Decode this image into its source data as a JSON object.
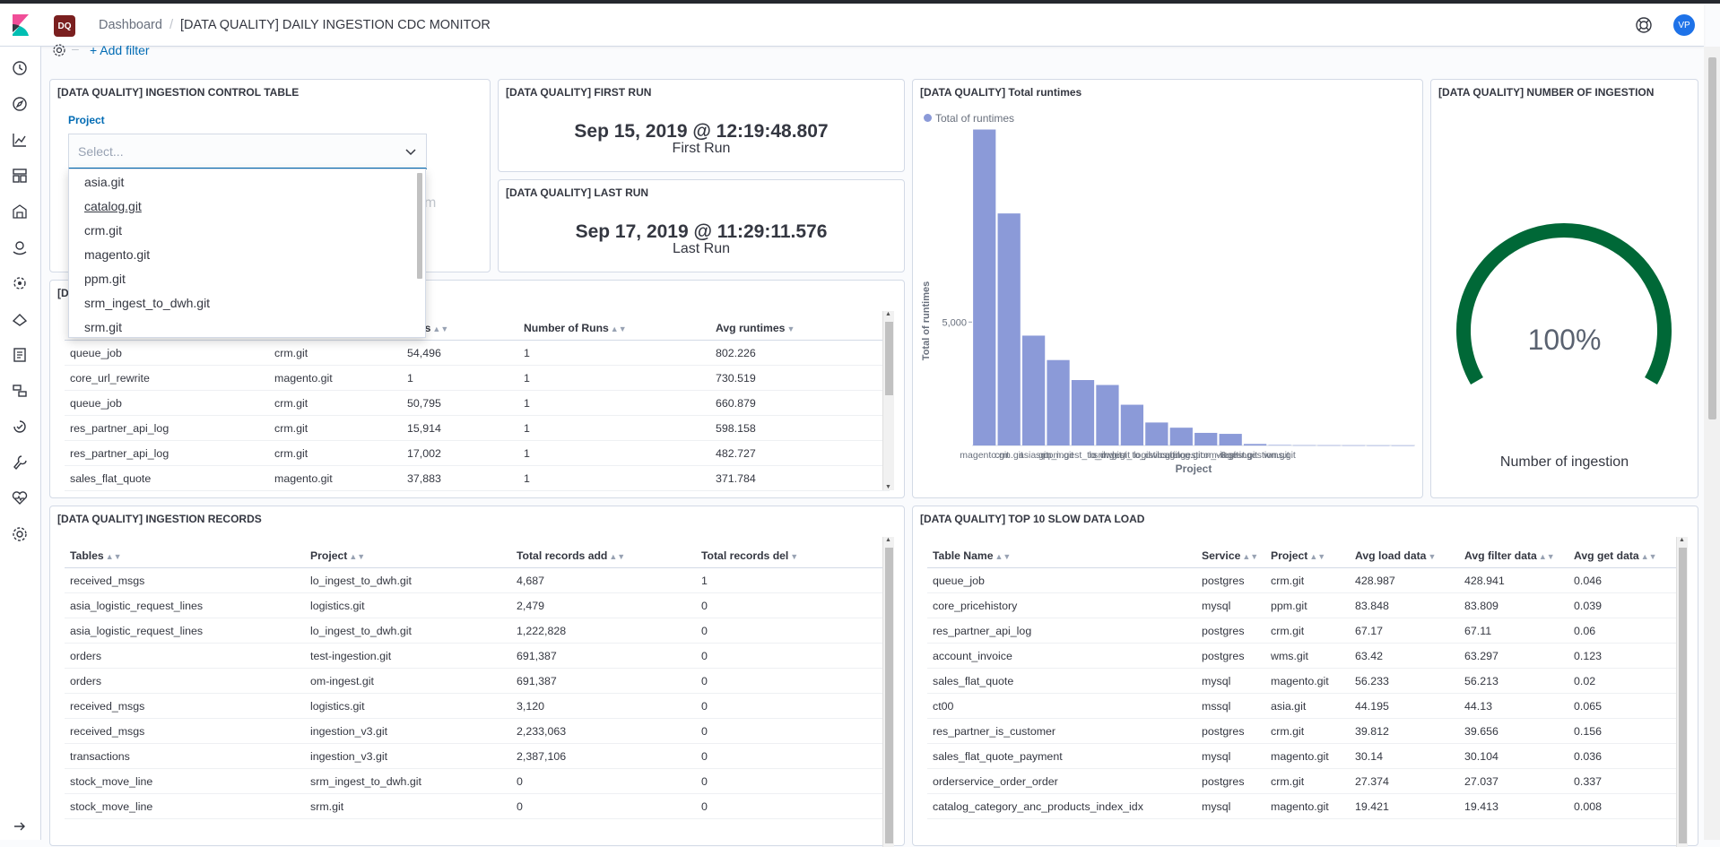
{
  "header": {
    "space_badge": "DQ",
    "breadcrumb_root": "Dashboard",
    "breadcrumb_sep": "/",
    "breadcrumb_current": "[DATA QUALITY] DAILY INGESTION CDC MONITOR",
    "avatar": "VP"
  },
  "filter_bar": {
    "add_filter": "+ Add filter",
    "separator": "–"
  },
  "control_panel": {
    "title": "[DATA QUALITY] INGESTION CONTROL TABLE",
    "project_label": "Project",
    "placeholder": "Select...",
    "options": [
      "asia.git",
      "catalog.git",
      "crm.git",
      "magento.git",
      "ppm.git",
      "srm_ingest_to_dwh.git",
      "srm.git"
    ],
    "hovered_option": "catalog.git",
    "obscured_text": "m"
  },
  "first_run": {
    "title": "[DATA QUALITY] FIRST RUN",
    "value": "Sep 15, 2019 @ 12:19:48.807",
    "label": "First Run"
  },
  "last_run": {
    "title": "[DATA QUALITY] LAST RUN",
    "value": "Sep 17, 2019 @ 11:29:11.576",
    "label": "Last Run"
  },
  "gauge_panel": {
    "title": "[DATA QUALITY] NUMBER OF INGESTION",
    "value": "100%",
    "fill_percent": 100,
    "label": "Number of ingestion",
    "color": "#006837"
  },
  "runtimes_table": {
    "title_fragment": "[D",
    "columns": [
      "",
      "",
      "Records",
      "Number of Runs",
      "Avg runtimes"
    ],
    "visible_header_fragment": "ords",
    "rows": [
      [
        "queue_job",
        "crm.git",
        "54,496",
        "1",
        "802.226"
      ],
      [
        "core_url_rewrite",
        "magento.git",
        "1",
        "1",
        "730.519"
      ],
      [
        "queue_job",
        "crm.git",
        "50,795",
        "1",
        "660.879"
      ],
      [
        "res_partner_api_log",
        "crm.git",
        "15,914",
        "1",
        "598.158"
      ],
      [
        "res_partner_api_log",
        "crm.git",
        "17,002",
        "1",
        "482.727"
      ],
      [
        "sales_flat_quote",
        "magento.git",
        "37,883",
        "1",
        "371.784"
      ]
    ]
  },
  "records_table": {
    "title": "[DATA QUALITY] INGESTION RECORDS",
    "columns": [
      "Tables",
      "Project",
      "Total records add",
      "Total records del"
    ],
    "rows": [
      [
        "received_msgs",
        "lo_ingest_to_dwh.git",
        "4,687",
        "1"
      ],
      [
        "asia_logistic_request_lines",
        "logistics.git",
        "2,479",
        "0"
      ],
      [
        "asia_logistic_request_lines",
        "lo_ingest_to_dwh.git",
        "1,222,828",
        "0"
      ],
      [
        "orders",
        "test-ingestion.git",
        "691,387",
        "0"
      ],
      [
        "orders",
        "om-ingest.git",
        "691,387",
        "0"
      ],
      [
        "received_msgs",
        "logistics.git",
        "3,120",
        "0"
      ],
      [
        "received_msgs",
        "ingestion_v3.git",
        "2,233,063",
        "0"
      ],
      [
        "transactions",
        "ingestion_v3.git",
        "2,387,106",
        "0"
      ],
      [
        "stock_move_line",
        "srm_ingest_to_dwh.git",
        "0",
        "0"
      ],
      [
        "stock_move_line",
        "srm.git",
        "0",
        "0"
      ]
    ]
  },
  "slow_table": {
    "title": "[DATA QUALITY] TOP 10 SLOW DATA LOAD",
    "columns": [
      "Table Name",
      "Service",
      "Project",
      "Avg load data",
      "Avg filter data",
      "Avg get data"
    ],
    "rows": [
      [
        "queue_job",
        "postgres",
        "crm.git",
        "428.987",
        "428.941",
        "0.046"
      ],
      [
        "core_pricehistory",
        "mysql",
        "ppm.git",
        "83.848",
        "83.809",
        "0.039"
      ],
      [
        "res_partner_api_log",
        "postgres",
        "crm.git",
        "67.17",
        "67.11",
        "0.06"
      ],
      [
        "account_invoice",
        "postgres",
        "wms.git",
        "63.42",
        "63.297",
        "0.123"
      ],
      [
        "sales_flat_quote",
        "mysql",
        "magento.git",
        "56.233",
        "56.213",
        "0.02"
      ],
      [
        "ct00",
        "mssql",
        "asia.git",
        "44.195",
        "44.13",
        "0.065"
      ],
      [
        "res_partner_is_customer",
        "postgres",
        "crm.git",
        "39.812",
        "39.656",
        "0.156"
      ],
      [
        "sales_flat_quote_payment",
        "mysql",
        "magento.git",
        "30.14",
        "30.104",
        "0.036"
      ],
      [
        "orderservice_order_order",
        "postgres",
        "crm.git",
        "27.374",
        "27.037",
        "0.337"
      ],
      [
        "catalog_category_anc_products_index_idx",
        "mysql",
        "magento.git",
        "19.421",
        "19.413",
        "0.008"
      ]
    ]
  },
  "chart_panel": {
    "title": "[DATA QUALITY] Total runtimes"
  },
  "chart_data": {
    "type": "bar",
    "title": "[DATA QUALITY] Total runtimes",
    "xlabel": "Project",
    "ylabel": "Total of runtimes",
    "legend": [
      "Total of runtimes"
    ],
    "legend_position": "top-left",
    "color": "#8b9ad8",
    "categories": [
      "magento.git",
      "crm.git",
      "asia.git",
      "ppm.git",
      "srm_ingest_to_dwh.git",
      "srm.git",
      "lo_ingest_to_dwh.git",
      "logistics.git",
      "catalog.git",
      "ingestion_v3.git",
      "om-ingest.git",
      "test-ingestion.git",
      "wms.git",
      "",
      "",
      "",
      "",
      ""
    ],
    "values": [
      12800,
      9400,
      4450,
      3460,
      2650,
      2450,
      1650,
      930,
      720,
      510,
      470,
      60,
      20,
      10,
      8,
      6,
      4,
      3
    ],
    "ylim": [
      0,
      13000
    ],
    "yticks": [
      5000
    ],
    "ytick_labels": [
      "5,000"
    ]
  },
  "icons": {
    "nav": [
      "clock-icon",
      "compass-icon",
      "visualize-icon",
      "dashboard-icon",
      "canvas-icon",
      "maps-icon",
      "ml-icon",
      "infra-icon",
      "logs-icon",
      "apm-icon",
      "uptime-icon",
      "devtools-icon",
      "monitoring-icon",
      "management-icon",
      "expand-icon"
    ]
  }
}
